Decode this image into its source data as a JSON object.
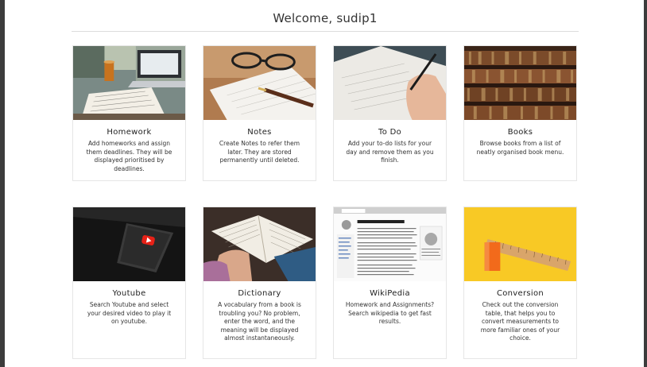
{
  "header": {
    "welcome_text": "Welcome, sudip1"
  },
  "cards": [
    {
      "title": "Homework",
      "description": "Add homeworks and assign them deadlines. They will be displayed prioritised by deadlines.",
      "image": "desk-laptop-notes-photo"
    },
    {
      "title": "Notes",
      "description": "Create Notes to refer them later. They are stored permanently until deleted.",
      "image": "notebook-glasses-pen-photo"
    },
    {
      "title": "To Do",
      "description": "Add your to-do lists for your day and remove them as you finish.",
      "image": "hand-writing-notebook-photo"
    },
    {
      "title": "Books",
      "description": "Browse books from a list of neatly organised book menu.",
      "image": "bookshelf-photo"
    },
    {
      "title": "Youtube",
      "description": "Search Youtube and select your desired video to play it on youtube.",
      "image": "phone-youtube-logo-photo"
    },
    {
      "title": "Dictionary",
      "description": "A vocabulary from a book is troubling you? No problem, enter the word, and the meaning will be displayed almost instantaneously.",
      "image": "open-book-hands-photo"
    },
    {
      "title": "WikiPedia",
      "description": "Homework and Assignments? Search wikipedia to get fast results.",
      "image": "wikipedia-page-screenshot"
    },
    {
      "title": "Conversion",
      "description": "Check out the conversion table, that helps you to convert measurements to more familiar ones of your choice.",
      "image": "ruler-yellow-background-photo"
    }
  ],
  "colors": {
    "youtube_red": "#e62117",
    "conversion_yellow": "#f7c51e",
    "ruler_orange": "#f26a1b"
  }
}
